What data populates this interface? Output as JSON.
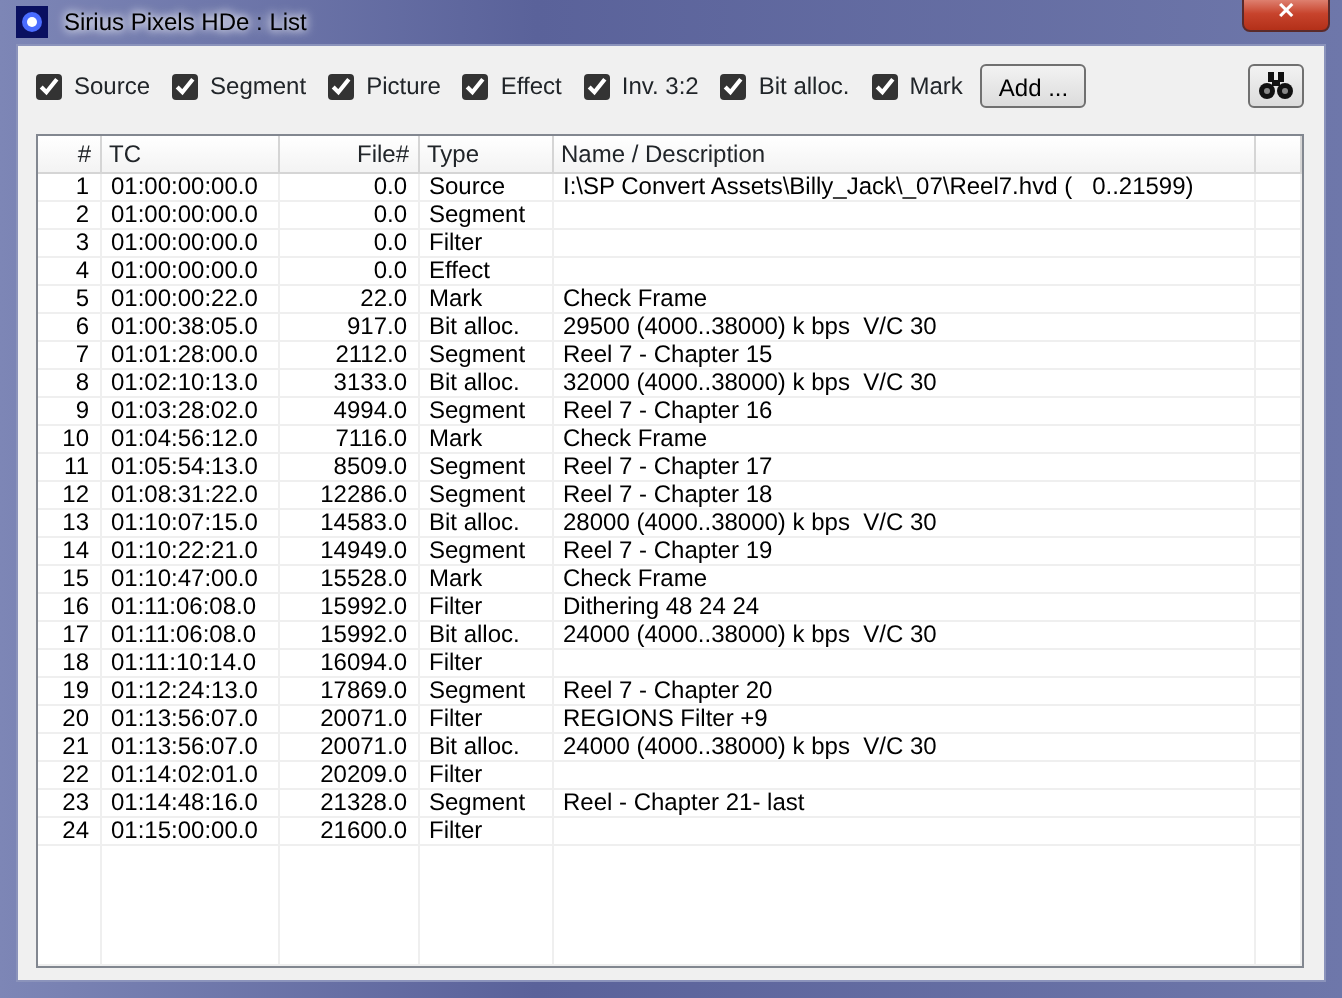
{
  "window": {
    "title": "Sirius Pixels HDe : List",
    "close": "✕"
  },
  "filters": [
    {
      "label": "Source",
      "checked": true
    },
    {
      "label": "Segment",
      "checked": true
    },
    {
      "label": "Picture",
      "checked": true
    },
    {
      "label": "Effect",
      "checked": true
    },
    {
      "label": "Inv. 3:2",
      "checked": true
    },
    {
      "label": "Bit alloc.",
      "checked": true
    },
    {
      "label": "Mark",
      "checked": true
    }
  ],
  "add_button": "Add ...",
  "table": {
    "columns": [
      "#",
      "TC",
      "File#",
      "Type",
      "Name / Description"
    ],
    "rows": [
      [
        "1",
        "01:00:00:00.0",
        "0.0",
        "Source",
        "I:\\SP Convert Assets\\Billy_Jack\\_07\\Reel7.hvd (   0..21599)"
      ],
      [
        "2",
        "01:00:00:00.0",
        "0.0",
        "Segment",
        ""
      ],
      [
        "3",
        "01:00:00:00.0",
        "0.0",
        "Filter",
        ""
      ],
      [
        "4",
        "01:00:00:00.0",
        "0.0",
        "Effect",
        ""
      ],
      [
        "5",
        "01:00:00:22.0",
        "22.0",
        "Mark",
        "Check Frame"
      ],
      [
        "6",
        "01:00:38:05.0",
        "917.0",
        "Bit alloc.",
        "29500 (4000..38000) k bps  V/C 30"
      ],
      [
        "7",
        "01:01:28:00.0",
        "2112.0",
        "Segment",
        "Reel 7 - Chapter 15"
      ],
      [
        "8",
        "01:02:10:13.0",
        "3133.0",
        "Bit alloc.",
        "32000 (4000..38000) k bps  V/C 30"
      ],
      [
        "9",
        "01:03:28:02.0",
        "4994.0",
        "Segment",
        "Reel 7 - Chapter 16"
      ],
      [
        "10",
        "01:04:56:12.0",
        "7116.0",
        "Mark",
        "Check Frame"
      ],
      [
        "11",
        "01:05:54:13.0",
        "8509.0",
        "Segment",
        "Reel 7 - Chapter 17"
      ],
      [
        "12",
        "01:08:31:22.0",
        "12286.0",
        "Segment",
        "Reel 7 - Chapter 18"
      ],
      [
        "13",
        "01:10:07:15.0",
        "14583.0",
        "Bit alloc.",
        "28000 (4000..38000) k bps  V/C 30"
      ],
      [
        "14",
        "01:10:22:21.0",
        "14949.0",
        "Segment",
        "Reel 7 - Chapter 19"
      ],
      [
        "15",
        "01:10:47:00.0",
        "15528.0",
        "Mark",
        "Check Frame"
      ],
      [
        "16",
        "01:11:06:08.0",
        "15992.0",
        "Filter",
        "Dithering 48 24 24"
      ],
      [
        "17",
        "01:11:06:08.0",
        "15992.0",
        "Bit alloc.",
        "24000 (4000..38000) k bps  V/C 30"
      ],
      [
        "18",
        "01:11:10:14.0",
        "16094.0",
        "Filter",
        ""
      ],
      [
        "19",
        "01:12:24:13.0",
        "17869.0",
        "Segment",
        "Reel 7 - Chapter 20"
      ],
      [
        "20",
        "01:13:56:07.0",
        "20071.0",
        "Filter",
        "REGIONS Filter +9"
      ],
      [
        "21",
        "01:13:56:07.0",
        "20071.0",
        "Bit alloc.",
        "24000 (4000..38000) k bps  V/C 30"
      ],
      [
        "22",
        "01:14:02:01.0",
        "20209.0",
        "Filter",
        ""
      ],
      [
        "23",
        "01:14:48:16.0",
        "21328.0",
        "Segment",
        "Reel - Chapter 21- last"
      ],
      [
        "24",
        "01:15:00:00.0",
        "21600.0",
        "Filter",
        ""
      ]
    ]
  }
}
